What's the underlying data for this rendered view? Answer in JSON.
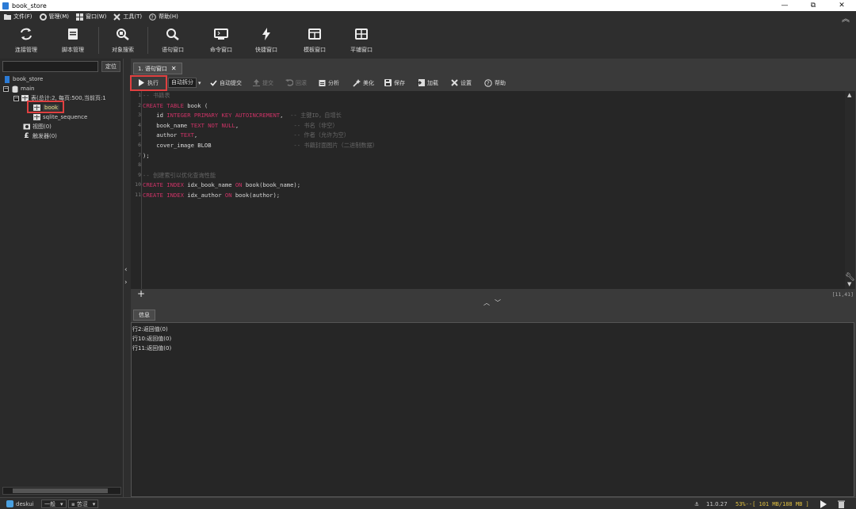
{
  "window": {
    "title": "book_store",
    "minimize": "—",
    "restore": "⧉",
    "close": "✕"
  },
  "menu": [
    {
      "label": "文件(F)",
      "icon": "folder-icon"
    },
    {
      "label": "管理(M)",
      "icon": "gear-icon"
    },
    {
      "label": "窗口(W)",
      "icon": "windows-icon"
    },
    {
      "label": "工具(T)",
      "icon": "tools-icon"
    },
    {
      "label": "帮助(H)",
      "icon": "help-icon"
    }
  ],
  "toolbar": [
    {
      "label": "连接管理",
      "icon": "refresh-arrows-icon"
    },
    {
      "label": "脚本管理",
      "icon": "script-book-icon"
    },
    {
      "label": "对象搜索",
      "icon": "object-search-icon"
    },
    {
      "label": "语句窗口",
      "icon": "search-icon"
    },
    {
      "label": "命令窗口",
      "icon": "command-window-icon"
    },
    {
      "label": "快捷窗口",
      "icon": "lightning-icon"
    },
    {
      "label": "模板窗口",
      "icon": "template-window-icon"
    },
    {
      "label": "平铺窗口",
      "icon": "tile-window-icon"
    }
  ],
  "left": {
    "locate_button": "定位",
    "tree": {
      "db": "book_store",
      "schema": "main",
      "tables_node": "表(总计:2, 每页:500,当前页:1",
      "table_book": "book",
      "table_seq": "sqlite_sequence",
      "views": "视图(0)",
      "triggers": "触发器(0)"
    }
  },
  "editor": {
    "tab_label": "1. 语句窗口",
    "toolbar": {
      "execute": "执行",
      "auto_split": "自动拆分",
      "auto_commit": "自动提交",
      "commit": "提交",
      "rollback": "回滚",
      "analyze": "分析",
      "beautify": "美化",
      "save": "保存",
      "load": "加载",
      "settings": "设置",
      "help": "帮助"
    },
    "lines": [
      {
        "n": "1",
        "html": "<span class=\"cm\">-- 书籍表</span>"
      },
      {
        "n": "2",
        "html": "<span class=\"kw\">CREATE TABLE</span> book ("
      },
      {
        "n": "3",
        "html": "    id <span class=\"kw\">INTEGER PRIMARY KEY AUTOINCREMENT</span>,  <span class=\"cm\">-- 主键ID，自增长</span>"
      },
      {
        "n": "4",
        "html": "    book_name <span class=\"kw\">TEXT NOT NULL</span>,                <span class=\"cm\">-- 书名（非空）</span>"
      },
      {
        "n": "5",
        "html": "    author <span class=\"kw\">TEXT</span>,                            <span class=\"cm\">-- 作者（允许为空）</span>"
      },
      {
        "n": "6",
        "html": "    cover_image BLOB                        <span class=\"cm\">-- 书籍封面图片（二进制数据）</span>"
      },
      {
        "n": "7",
        "html": ");"
      },
      {
        "n": "8",
        "html": ""
      },
      {
        "n": "9",
        "html": "<span class=\"cm\">-- 创建索引以优化查询性能</span>"
      },
      {
        "n": "10",
        "html": "<span class=\"kw\">CREATE INDEX</span> idx_book_name <span class=\"kw\">ON</span> book(book_name);"
      },
      {
        "n": "11",
        "html": "<span class=\"kw\">CREATE INDEX</span> idx_author <span class=\"kw\">ON</span> book(author);"
      }
    ],
    "cursor_pos": "[11,41]",
    "add_label": "+"
  },
  "info": {
    "tab_label": "信息",
    "lines": [
      "行2:返回值(0)",
      "行10:返回值(0)",
      "行11:返回值(0)"
    ]
  },
  "status": {
    "user": "deskui",
    "mode": "一般",
    "scope": "苦涩",
    "version": "11.0.27",
    "memory": "53%--[ 101 MB/188 MB ]"
  },
  "colors": {
    "keyword": "#cc3366",
    "comment": "#666666",
    "highlight": "#e04040",
    "memory": "#e0c040"
  }
}
